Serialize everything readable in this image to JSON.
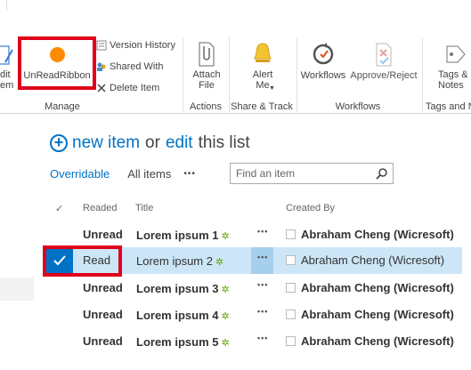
{
  "ribbon": {
    "edit_item_partial": "dit\nem",
    "unread_ribbon": "UnReadRibbon",
    "version_history": "Version History",
    "shared_with": "Shared With",
    "delete_item": "Delete Item",
    "manage_label": "Manage",
    "attach_file": "Attach\nFile",
    "actions_label": "Actions",
    "alert_me": "Alert\nMe",
    "share_track_label": "Share & Track",
    "workflows": "Workflows",
    "approve_reject": "Approve/Reject",
    "workflows_label": "Workflows",
    "tags_notes": "Tags &\nNotes",
    "tags_notes_label": "Tags and N"
  },
  "toolbar": {
    "new_item": "new item",
    "or": "or",
    "edit": "edit",
    "this_list": "this list"
  },
  "views": {
    "overridable": "Overridable",
    "all_items": "All items",
    "more": "•••"
  },
  "search": {
    "placeholder": "Find an item"
  },
  "columns": {
    "check": "✓",
    "readed": "Readed",
    "title": "Title",
    "created_by": "Created By"
  },
  "rows": [
    {
      "readed": "Unread",
      "title": "Lorem ipsum 1",
      "created_by": "Abraham Cheng (Wicresoft)"
    },
    {
      "readed": "Read",
      "title": "Lorem ipsum 2",
      "created_by": "Abraham Cheng (Wicresoft)"
    },
    {
      "readed": "Unread",
      "title": "Lorem ipsum 3",
      "created_by": "Abraham Cheng (Wicresoft)"
    },
    {
      "readed": "Unread",
      "title": "Lorem ipsum 4",
      "created_by": "Abraham Cheng (Wicresoft)"
    },
    {
      "readed": "Unread",
      "title": "Lorem ipsum 5",
      "created_by": "Abraham Cheng (Wicresoft)"
    }
  ],
  "ellipsis": "•••",
  "new_badge": "✲",
  "colors": {
    "accent": "#0072c6",
    "highlight": "#e0001b",
    "selected_row": "#cde6f7",
    "unread_icon": "#ff8c00"
  }
}
